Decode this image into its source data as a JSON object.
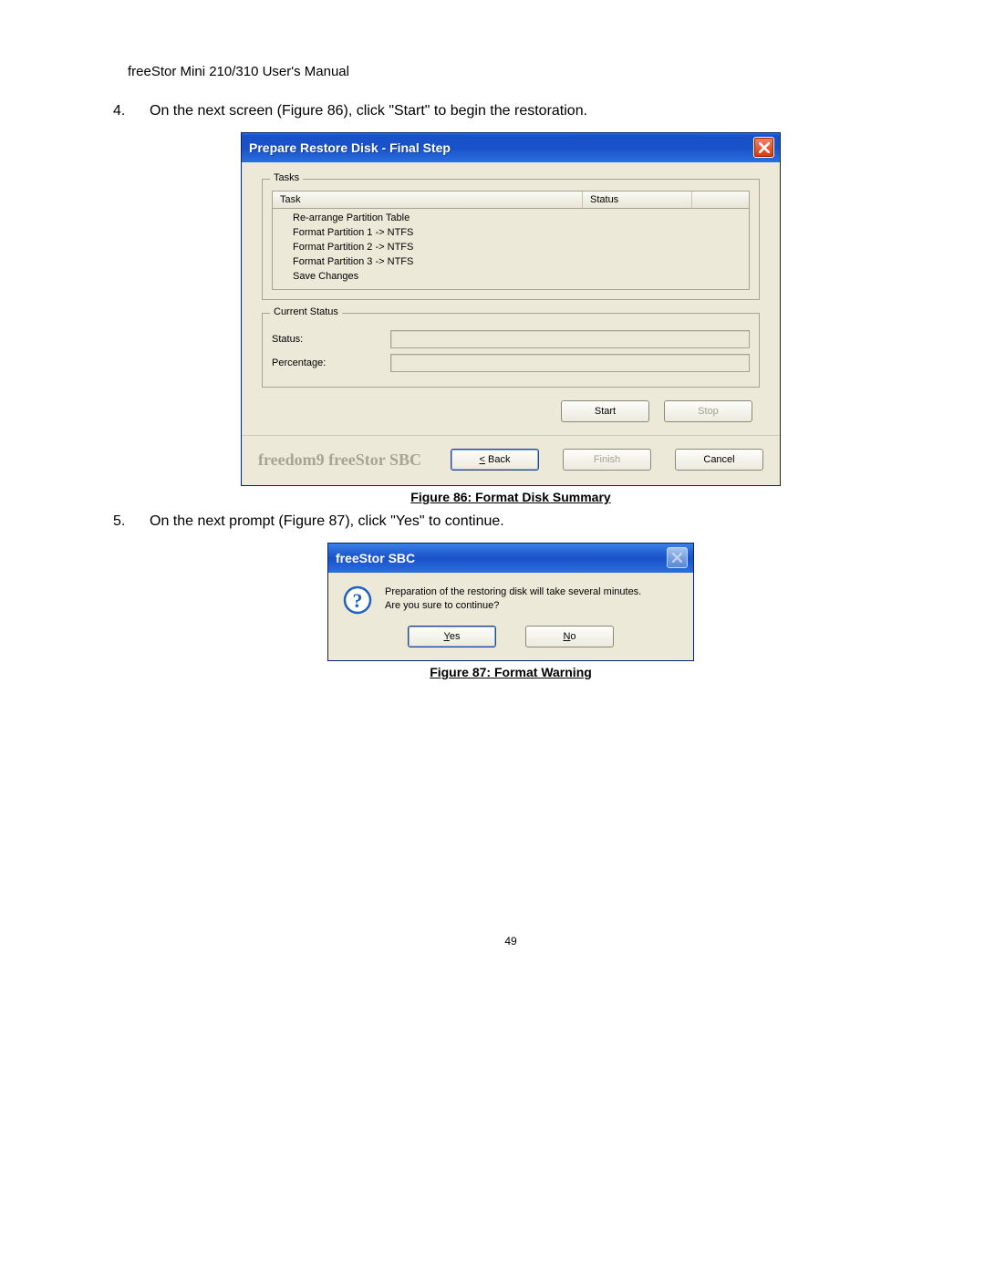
{
  "doc": {
    "header": "freeStor Mini 210/310 User's Manual",
    "step4_num": "4.",
    "step4": "On the next screen (Figure 86), click \"Start\" to begin the restoration.",
    "fig86_caption": "Figure 86: Format Disk Summary",
    "step5_num": "5.",
    "step5": "On the next prompt (Figure 87), click \"Yes\" to continue.",
    "fig87_caption": "Figure 87: Format Warning",
    "page_num": "49"
  },
  "dlg86": {
    "title": "Prepare Restore Disk - Final Step",
    "tasks_legend": "Tasks",
    "col_task": "Task",
    "col_status": "Status",
    "tasks": [
      "Re-arrange Partition Table",
      "Format Partition 1 -> NTFS",
      "Format Partition 2 -> NTFS",
      "Format Partition 3 -> NTFS",
      "Save Changes"
    ],
    "current_status_legend": "Current Status",
    "status_label": "Status:",
    "percentage_label": "Percentage:",
    "btn_start": "Start",
    "btn_stop": "Stop",
    "brand": "freedom9 freeStor SBC",
    "btn_back": "< Back",
    "btn_finish": "Finish",
    "btn_cancel": "Cancel"
  },
  "dlg87": {
    "title": "freeStor SBC",
    "msg_line1": "Preparation of the restoring disk will take several minutes.",
    "msg_line2": "Are you sure to continue?",
    "btn_yes": "Yes",
    "btn_no": "No"
  }
}
